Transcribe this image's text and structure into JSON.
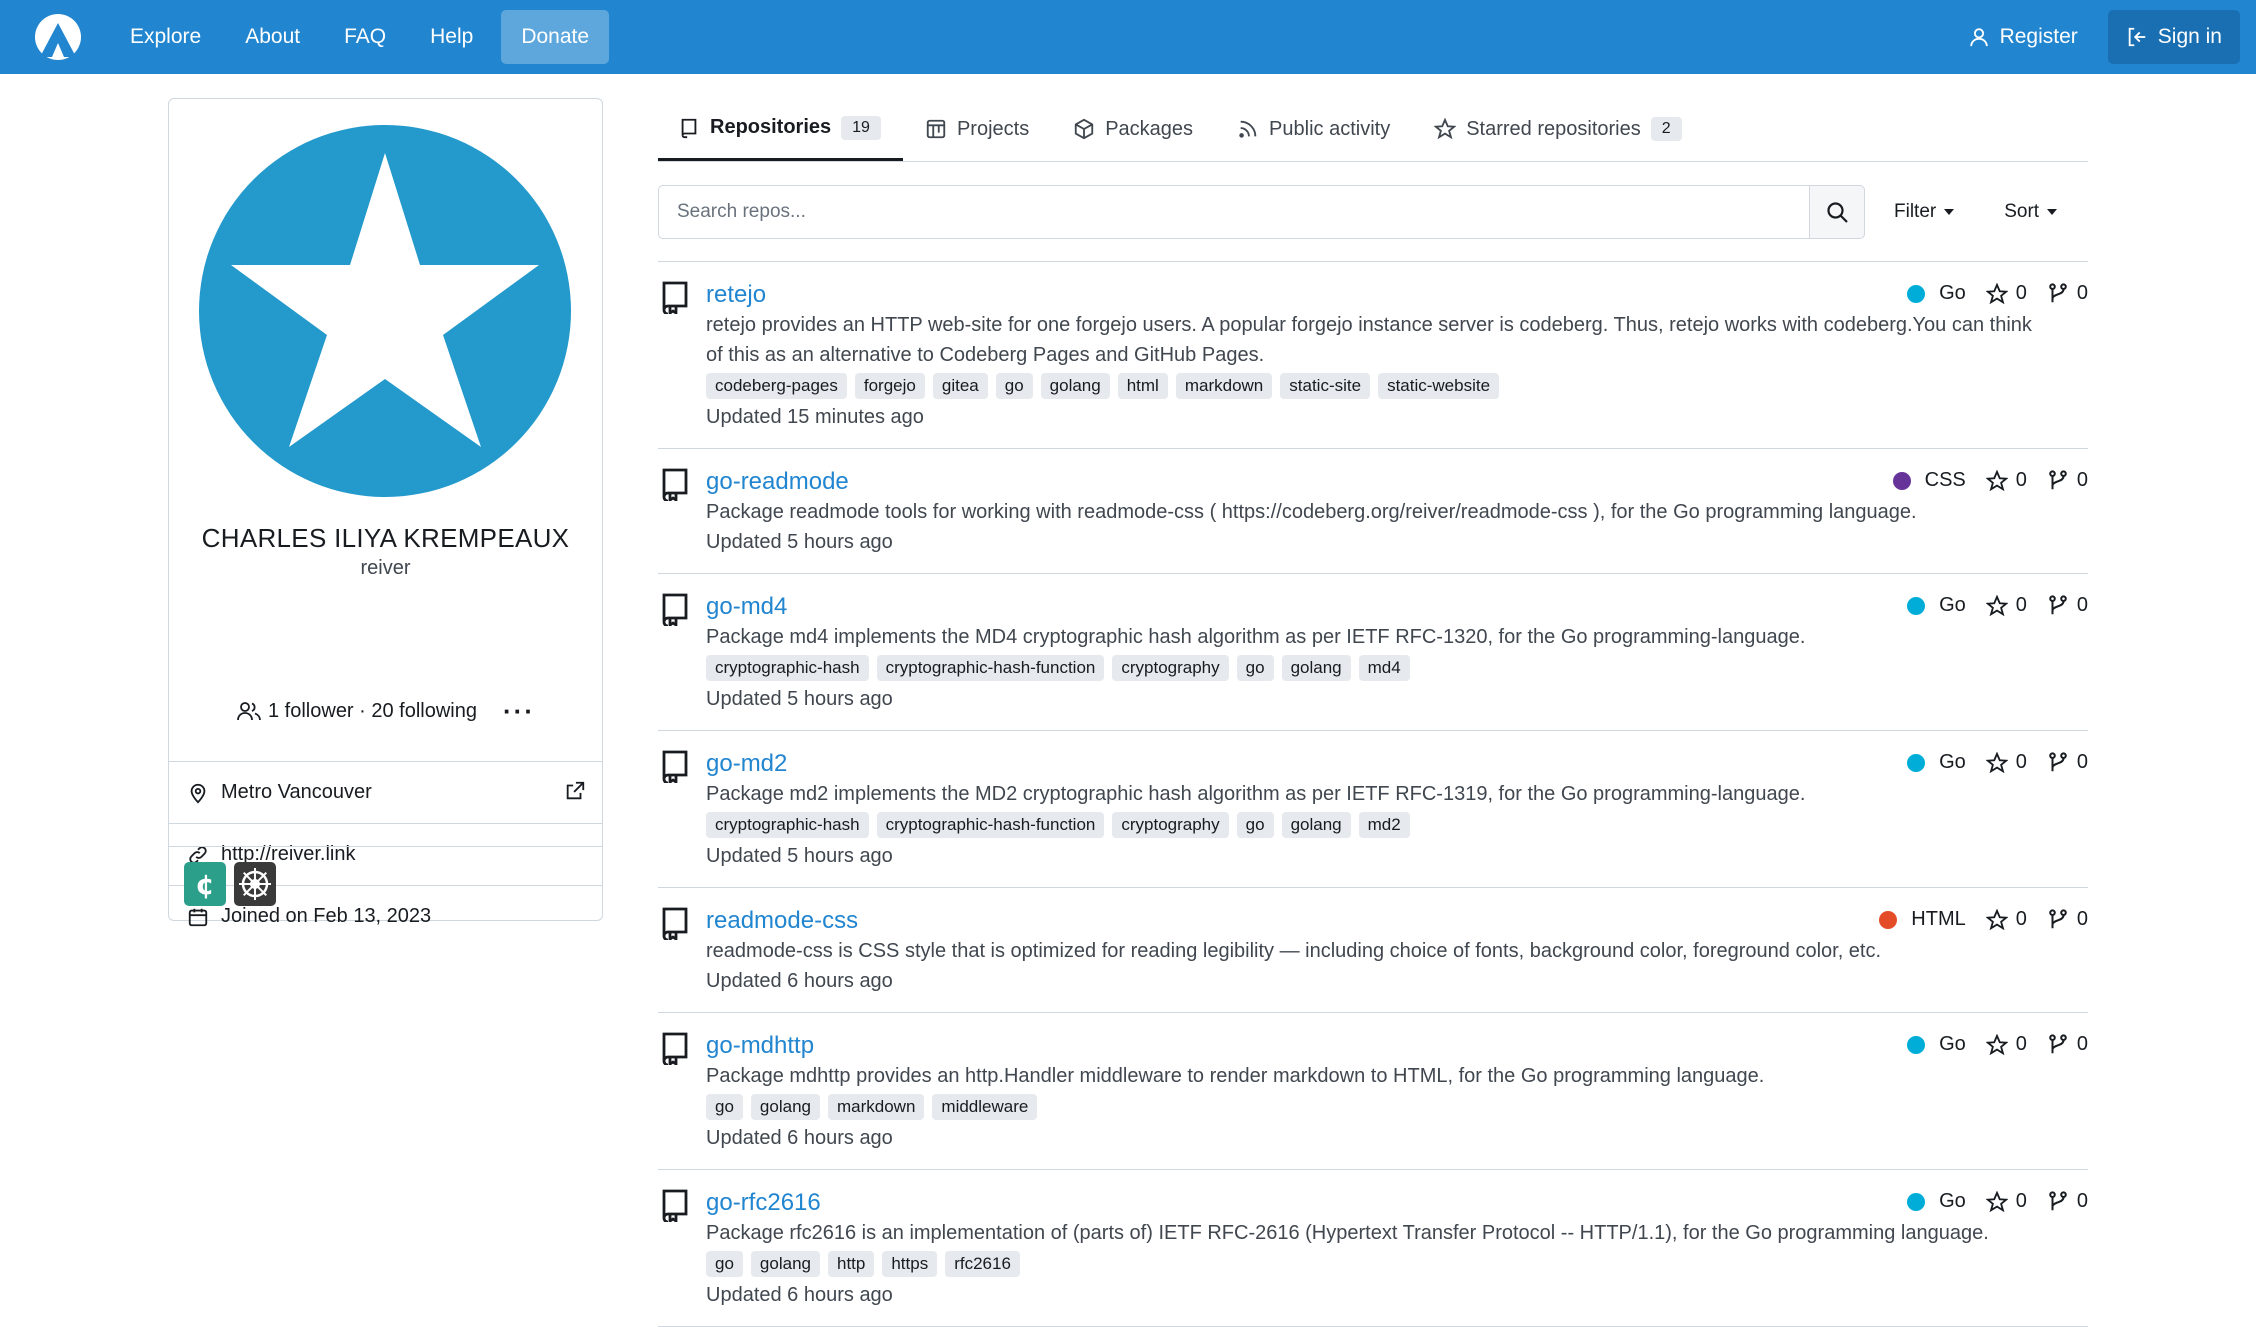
{
  "nav": {
    "items": [
      "Explore",
      "About",
      "FAQ",
      "Help"
    ],
    "donate_label": "Donate",
    "register_label": "Register",
    "signin_label": "Sign in"
  },
  "profile": {
    "display_name": "CHARLES ILIYA KREMPEAUX",
    "username": "reiver",
    "followers_text": "1 follower · 20 following",
    "location": "Metro Vancouver",
    "website": "http://reiver.link",
    "joined": "Joined on Feb 13, 2023",
    "avatar_color": "#2399cc"
  },
  "tabs": [
    {
      "label": "Repositories",
      "count": "19",
      "icon": "repo-icon"
    },
    {
      "label": "Projects",
      "count": "",
      "icon": "projects-icon"
    },
    {
      "label": "Packages",
      "count": "",
      "icon": "package-icon"
    },
    {
      "label": "Public activity",
      "count": "",
      "icon": "rss-icon"
    },
    {
      "label": "Starred repositories",
      "count": "2",
      "icon": "star-icon"
    }
  ],
  "search": {
    "placeholder": "Search repos...",
    "filter_label": "Filter",
    "sort_label": "Sort"
  },
  "colors": {
    "primary": "#2185d0",
    "go": "#00add8",
    "css": "#663399",
    "html": "#e34c26"
  },
  "repos": [
    {
      "name": "retejo",
      "description": "retejo provides an HTTP web-site for one forgejo users. A popular forgejo instance server is codeberg. Thus, retejo works with codeberg.You can think of this as an alternative to Codeberg Pages and GitHub Pages.",
      "topics": [
        "codeberg-pages",
        "forgejo",
        "gitea",
        "go",
        "golang",
        "html",
        "markdown",
        "static-site",
        "static-website"
      ],
      "updated": "Updated 15 minutes ago",
      "language": "Go",
      "lang_color": "#00add8",
      "stars": "0",
      "forks": "0"
    },
    {
      "name": "go-readmode",
      "description": "Package readmode tools for working with readmode-css ( https://codeberg.org/reiver/readmode-css ), for the Go programming language.",
      "topics": [],
      "updated": "Updated 5 hours ago",
      "language": "CSS",
      "lang_color": "#663399",
      "stars": "0",
      "forks": "0"
    },
    {
      "name": "go-md4",
      "description": "Package md4 implements the MD4 cryptographic hash algorithm as per IETF RFC-1320, for the Go programming-language.",
      "topics": [
        "cryptographic-hash",
        "cryptographic-hash-function",
        "cryptography",
        "go",
        "golang",
        "md4"
      ],
      "updated": "Updated 5 hours ago",
      "language": "Go",
      "lang_color": "#00add8",
      "stars": "0",
      "forks": "0"
    },
    {
      "name": "go-md2",
      "description": "Package md2 implements the MD2 cryptographic hash algorithm as per IETF RFC-1319, for the Go programming-language.",
      "topics": [
        "cryptographic-hash",
        "cryptographic-hash-function",
        "cryptography",
        "go",
        "golang",
        "md2"
      ],
      "updated": "Updated 5 hours ago",
      "language": "Go",
      "lang_color": "#00add8",
      "stars": "0",
      "forks": "0"
    },
    {
      "name": "readmode-css",
      "description": "readmode-css is CSS style that is optimized for reading legibility — including choice of fonts, background color, foreground color, etc.",
      "topics": [],
      "updated": "Updated 6 hours ago",
      "language": "HTML",
      "lang_color": "#e34c26",
      "stars": "0",
      "forks": "0"
    },
    {
      "name": "go-mdhttp",
      "description": "Package mdhttp provides an http.Handler middleware to render markdown to HTML, for the Go programming language.",
      "topics": [
        "go",
        "golang",
        "markdown",
        "middleware"
      ],
      "updated": "Updated 6 hours ago",
      "language": "Go",
      "lang_color": "#00add8",
      "stars": "0",
      "forks": "0"
    },
    {
      "name": "go-rfc2616",
      "description": "Package rfc2616 is an implementation of (parts of) IETF RFC-2616 (Hypertext Transfer Protocol -- HTTP/1.1), for the Go programming language.",
      "topics": [
        "go",
        "golang",
        "http",
        "https",
        "rfc2616"
      ],
      "updated": "Updated 6 hours ago",
      "language": "Go",
      "lang_color": "#00add8",
      "stars": "0",
      "forks": "0"
    }
  ]
}
